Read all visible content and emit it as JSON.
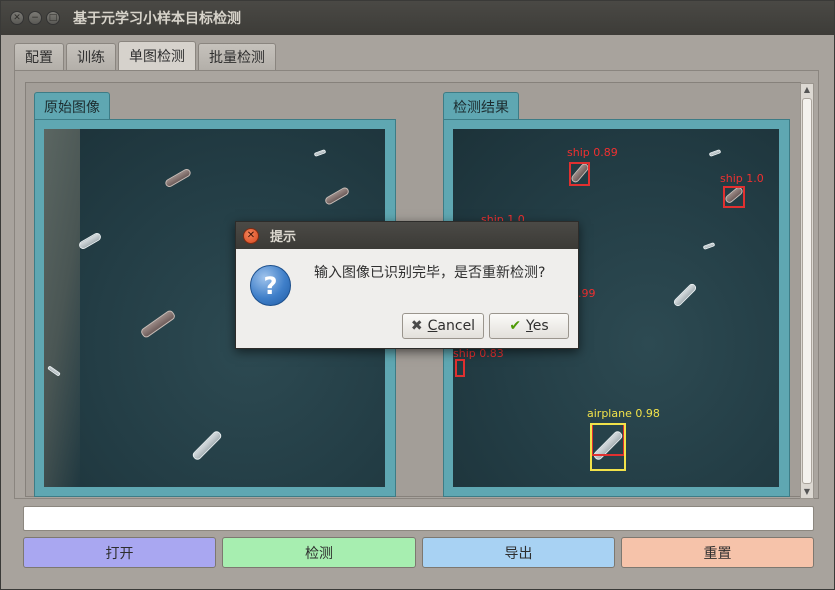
{
  "window": {
    "title": "基于元学习小样本目标检测",
    "controls": [
      "close",
      "minimize",
      "maximize"
    ]
  },
  "tabs": [
    {
      "label": "配置",
      "active": false
    },
    {
      "label": "训练",
      "active": false
    },
    {
      "label": "单图检测",
      "active": true
    },
    {
      "label": "批量检测",
      "active": false
    }
  ],
  "panels": {
    "original": {
      "title": "原始图像"
    },
    "result": {
      "title": "检测结果",
      "detections": [
        {
          "label": "ship 0.89"
        },
        {
          "label": "ship 1.0"
        },
        {
          "label": "ship 1.0"
        },
        {
          "label": ".99"
        },
        {
          "label": "ship 0.83"
        },
        {
          "label": "airplane 0.98"
        }
      ]
    }
  },
  "output_line": {
    "value": ""
  },
  "buttons": {
    "open": {
      "label": "打开",
      "color": "#a9a7f1"
    },
    "detect": {
      "label": "检测",
      "color": "#a7eeb0"
    },
    "export": {
      "label": "导出",
      "color": "#a8d2f3"
    },
    "reset": {
      "label": "重置",
      "color": "#f6c3aa"
    }
  },
  "dialog": {
    "title": "提示",
    "message": "输入图像已识别完毕，是否重新检测?",
    "icon": "question-icon",
    "cancel": {
      "mnemonic": "C",
      "rest": "ancel"
    },
    "yes": {
      "mnemonic": "Y",
      "rest": "es"
    }
  }
}
